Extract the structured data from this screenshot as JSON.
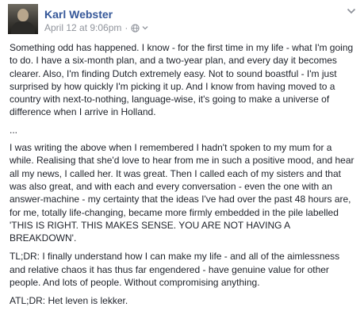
{
  "author": {
    "name": "Karl Webster",
    "timestamp": "April 12 at 9:06pm",
    "separator": "·",
    "privacy_icon": "globe-icon",
    "menu_icon": "chevron-down-icon"
  },
  "colors": {
    "link": "#365899",
    "meta": "#90949c",
    "text": "#1d2129"
  },
  "post": {
    "paragraphs": [
      "Something odd has happened. I know - for the first time in my life - what I'm going to do. I have a six-month plan, and a two-year plan, and every day it becomes clearer. Also, I'm finding Dutch extremely easy. Not to sound boastful - I'm just surprised by how quickly I'm picking it up. And I know from having moved to a country with next-to-nothing, language-wise, it's going to make a universe of difference when I arrive in Holland.",
      "...",
      "I was writing the above when I remembered I hadn't spoken to my mum for a while. Realising that she'd love to hear from me in such a positive mood, and hear all my news, I called her. It was great. Then I called each of my sisters and that was also great, and with each and every conversation - even the one with an answer-machine - my certainty that the ideas I've had over the past 48 hours are, for me, totally life-changing, became more firmly embedded in the pile labelled 'THIS IS RIGHT. THIS MAKES SENSE. YOU ARE NOT HAVING A BREAKDOWN'.",
      "TL;DR: I finally understand how I can make my life - and all of the aimlessness and relative chaos it has thus far engendered - have genuine value for other people. And lots of people. Without compromising anything.",
      "ATL;DR: Het leven is lekker."
    ]
  }
}
